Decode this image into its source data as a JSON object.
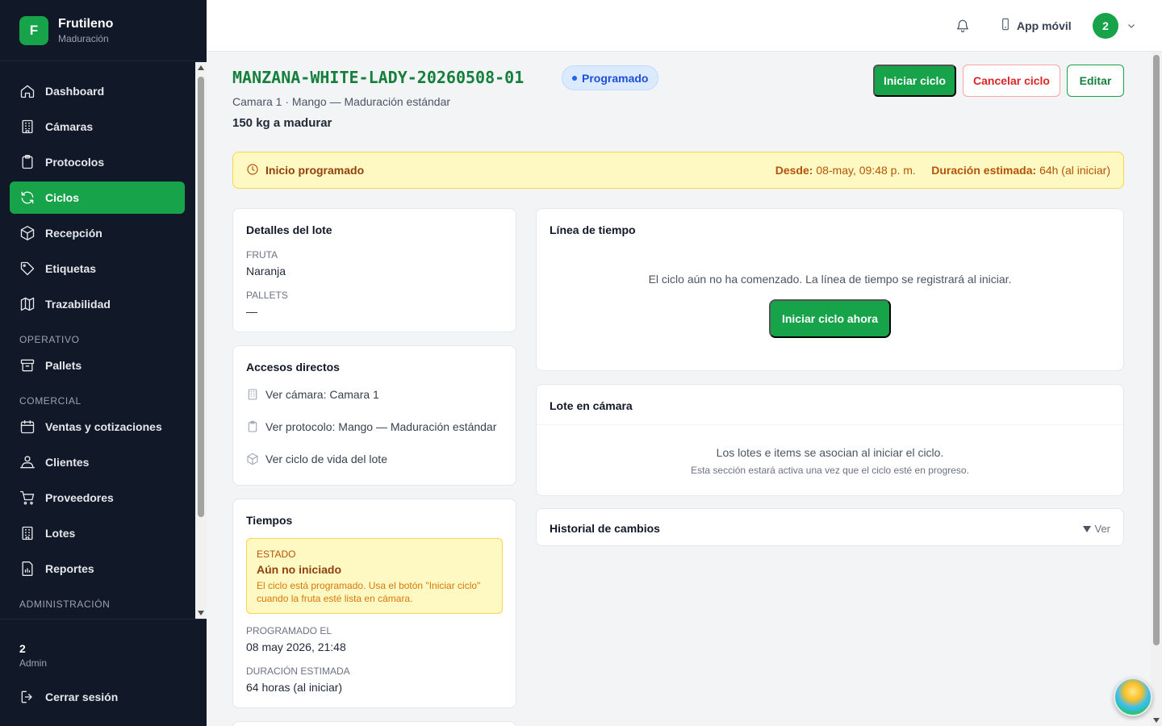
{
  "brand": {
    "initial": "F",
    "name": "Frutileno",
    "subtitle": "Maduración"
  },
  "nav": {
    "items": [
      {
        "label": "Dashboard",
        "icon": "home-icon"
      },
      {
        "label": "Cámaras",
        "icon": "building-icon"
      },
      {
        "label": "Protocolos",
        "icon": "clipboard-icon"
      },
      {
        "label": "Ciclos",
        "icon": "refresh-icon",
        "active": true
      },
      {
        "label": "Recepción",
        "icon": "box-icon"
      },
      {
        "label": "Etiquetas",
        "icon": "tag-icon"
      },
      {
        "label": "Trazabilidad",
        "icon": "map-icon"
      }
    ],
    "section_operativo": "OPERATIVO",
    "operativo": [
      {
        "label": "Pallets",
        "icon": "archive-icon"
      }
    ],
    "section_comercial": "COMERCIAL",
    "comercial": [
      {
        "label": "Ventas y cotizaciones",
        "icon": "calendar-icon"
      },
      {
        "label": "Clientes",
        "icon": "users-icon"
      },
      {
        "label": "Proveedores",
        "icon": "cart-icon"
      },
      {
        "label": "Lotes",
        "icon": "building-icon"
      },
      {
        "label": "Reportes",
        "icon": "report-icon"
      }
    ],
    "section_admin": "ADMINISTRACIÓN"
  },
  "user": {
    "name": "2",
    "role": "Admin",
    "logout": "Cerrar sesión"
  },
  "topbar": {
    "app_movil": "App móvil",
    "avatar": "2"
  },
  "header": {
    "title": "MANZANA-WHITE-LADY-20260508-01",
    "status": "Programado",
    "subline": "Camara 1 · Mango — Maduración estándar",
    "kg": "150 kg a madurar",
    "btn_start": "Iniciar ciclo",
    "btn_cancel": "Cancelar ciclo",
    "btn_edit": "Editar"
  },
  "alert": {
    "title": "Inicio programado",
    "desde_label": "Desde:",
    "desde_value": "08-may, 09:48 p. m.",
    "duracion_label": "Duración estimada:",
    "duracion_value": "64h (al iniciar)"
  },
  "lote": {
    "title": "Detalles del lote",
    "fruta_label": "FRUTA",
    "fruta_value": "Naranja",
    "pallets_label": "PALLETS",
    "pallets_value": "—"
  },
  "accesos": {
    "title": "Accesos directos",
    "links": [
      "Ver cámara: Camara 1",
      "Ver protocolo: Mango — Maduración estándar",
      "Ver ciclo de vida del lote"
    ]
  },
  "tiempos": {
    "title": "Tiempos",
    "estado_label": "ESTADO",
    "estado_value": "Aún no iniciado",
    "estado_note": "El ciclo está programado. Usa el botón \"Iniciar ciclo\" cuando la fruta esté lista en cámara.",
    "programado_label": "PROGRAMADO EL",
    "programado_value": "08 may 2026, 21:48",
    "duracion_label": "DURACIÓN ESTIMADA",
    "duracion_value": "64 horas (al iniciar)"
  },
  "timeline": {
    "title": "Línea de tiempo",
    "message": "El ciclo aún no ha comenzado. La línea de tiempo se registrará al iniciar.",
    "button": "Iniciar ciclo ahora"
  },
  "lote_camara": {
    "title": "Lote en cámara",
    "message": "Los lotes e items se asocian al iniciar el ciclo.",
    "note": "Esta sección estará activa una vez que el ciclo esté en progreso."
  },
  "historial": {
    "title": "Historial de cambios",
    "toggle": "Ver"
  }
}
